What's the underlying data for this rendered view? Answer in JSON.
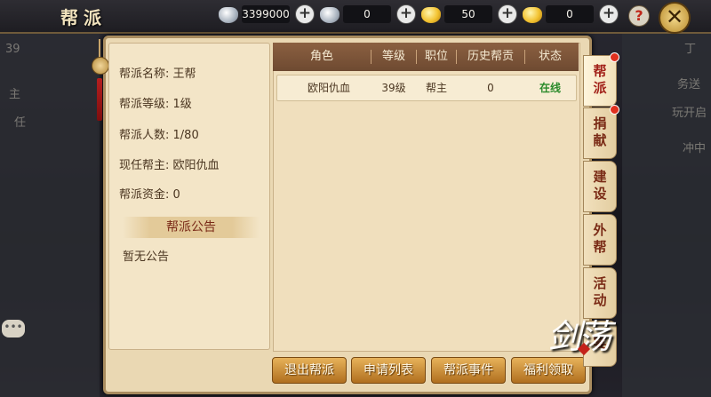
{
  "header": {
    "title": "帮派",
    "currencies": [
      {
        "icon": "silver-ingot-icon",
        "value": "3399000"
      },
      {
        "icon": "silver-coin-icon",
        "value": "0"
      },
      {
        "icon": "gold-ingot-icon",
        "value": "50"
      },
      {
        "icon": "gold-bound-ingot-icon",
        "value": "0"
      }
    ],
    "plus": "+",
    "help": "?",
    "close": "✕"
  },
  "background": {
    "left_level": "39",
    "left_label_1": "主",
    "left_label_2": "任",
    "right_label_1": "丁",
    "right_label_2": "务送",
    "right_label_3": "玩开启",
    "right_label_4": "冲中"
  },
  "info": {
    "rows": [
      {
        "label": "帮派名称: ",
        "value": "王帮"
      },
      {
        "label": "帮派等级: ",
        "value": "1级"
      },
      {
        "label": "帮派人数: ",
        "value": "1/80"
      },
      {
        "label": "现任帮主: ",
        "value": "欧阳仇血"
      },
      {
        "label": "帮派资金: ",
        "value": "0"
      }
    ],
    "notice_title": "帮派公告",
    "notice_body": "暂无公告"
  },
  "table": {
    "headers": [
      "角色",
      "等级",
      "职位",
      "历史帮贡",
      "状态"
    ],
    "rows": [
      {
        "role": "欧阳仇血",
        "level": "39级",
        "position": "帮主",
        "contribution": "0",
        "status": "在线"
      }
    ]
  },
  "buttons": [
    "退出帮派",
    "申请列表",
    "帮派事件",
    "福利领取"
  ],
  "tabs": [
    "帮派",
    "捐献",
    "建设",
    "外帮",
    "活动",
    "宴"
  ],
  "logo": "剑荡",
  "colors": {
    "accent": "#a2221a",
    "online": "#2a8a2a",
    "button": "#e7b25a"
  }
}
